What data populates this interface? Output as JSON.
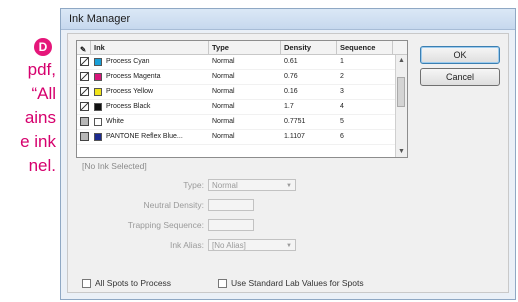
{
  "document": {
    "badge": "D",
    "lines": [
      "pdf,",
      "“All",
      "ains",
      "e ink",
      "nel."
    ]
  },
  "dialog": {
    "title": "Ink Manager",
    "columns": [
      "",
      "Ink",
      "Type",
      "Density",
      "Sequence"
    ],
    "inks": [
      {
        "name": "Process Cyan",
        "type": "Normal",
        "density": "0.61",
        "sequence": "1",
        "color": "#1aa0d8",
        "mode": "process"
      },
      {
        "name": "Process Magenta",
        "type": "Normal",
        "density": "0.76",
        "sequence": "2",
        "color": "#d6167a",
        "mode": "process"
      },
      {
        "name": "Process Yellow",
        "type": "Normal",
        "density": "0.16",
        "sequence": "3",
        "color": "#f2e51a",
        "mode": "process"
      },
      {
        "name": "Process Black",
        "type": "Normal",
        "density": "1.7",
        "sequence": "4",
        "color": "#111111",
        "mode": "process"
      },
      {
        "name": "White",
        "type": "Normal",
        "density": "0.7751",
        "sequence": "5",
        "color": "#ffffff",
        "mode": "spot"
      },
      {
        "name": "PANTONE Reflex Blue...",
        "type": "Normal",
        "density": "1.1107",
        "sequence": "6",
        "color": "#1d2a8f",
        "mode": "spot"
      }
    ],
    "buttons": {
      "ok": "OK",
      "cancel": "Cancel"
    },
    "no_ink": "[No Ink Selected]",
    "fields": {
      "type_label": "Type:",
      "type_value": "Normal",
      "neutral_label": "Neutral Density:",
      "neutral_value": "",
      "trapping_label": "Trapping Sequence:",
      "trapping_value": "",
      "alias_label": "Ink Alias:",
      "alias_value": "[No Alias]"
    },
    "options": {
      "all_spots": "All Spots to Process",
      "lab_values": "Use Standard Lab Values for Spots"
    }
  }
}
